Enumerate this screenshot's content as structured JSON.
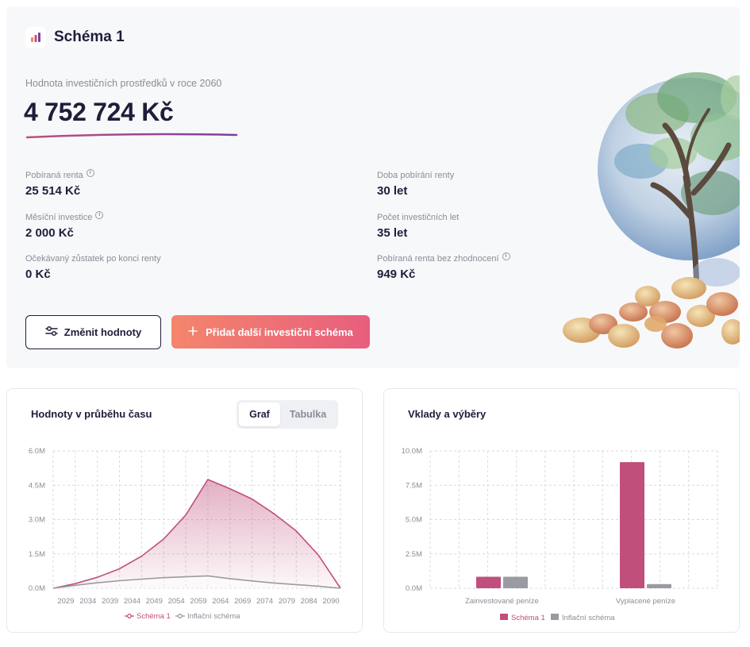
{
  "header": {
    "title": "Schéma 1",
    "subtitle": "Hodnota investičních prostředků v roce 2060",
    "value": "4 752 724 Kč"
  },
  "stats": {
    "rent_label": "Pobíraná renta",
    "rent_value": "25 514 Kč",
    "duration_label": "Doba pobírání renty",
    "duration_value": "30 let",
    "monthly_label": "Měsíční investice",
    "monthly_value": "2 000 Kč",
    "years_label": "Počet investičních let",
    "years_value": "35 let",
    "remaining_label": "Očekávaný zůstatek po konci renty",
    "remaining_value": "0 Kč",
    "rent_noval_label": "Pobíraná renta bez zhodnocení",
    "rent_noval_value": "949 Kč"
  },
  "buttons": {
    "change": "Změnit hodnoty",
    "add": "Přidat další investiční schéma"
  },
  "left_card": {
    "title": "Hodnoty v průběhu času",
    "tab_graph": "Graf",
    "tab_table": "Tabulka"
  },
  "right_card": {
    "title": "Vklady a výběry"
  },
  "colors": {
    "scheme": "#c04f7c",
    "inflation": "#9a9aa3",
    "accent_start": "#f4856c",
    "accent_end": "#e85e7e"
  },
  "chart_data": [
    {
      "type": "area",
      "x_ticks": [
        "2029",
        "2034",
        "2039",
        "2044",
        "2049",
        "2054",
        "2059",
        "2064",
        "2069",
        "2074",
        "2079",
        "2084",
        "2090"
      ],
      "y_ticks": [
        "6.0M",
        "4.5M",
        "3.0M",
        "1.5M",
        "0.0M"
      ],
      "ylim": [
        0,
        6000000
      ],
      "xlim": [
        2025,
        2090
      ],
      "grid": true,
      "legend_position": "bottom",
      "series": [
        {
          "name": "Schéma 1",
          "color": "#c04f7c",
          "points": [
            [
              2025,
              0
            ],
            [
              2030,
              200000
            ],
            [
              2035,
              480000
            ],
            [
              2040,
              850000
            ],
            [
              2045,
              1400000
            ],
            [
              2050,
              2150000
            ],
            [
              2055,
              3200000
            ],
            [
              2060,
              4750000
            ],
            [
              2065,
              4350000
            ],
            [
              2070,
              3900000
            ],
            [
              2075,
              3250000
            ],
            [
              2080,
              2500000
            ],
            [
              2085,
              1450000
            ],
            [
              2090,
              0
            ]
          ]
        },
        {
          "name": "Inflační schéma",
          "color": "#9a9aa3",
          "points": [
            [
              2025,
              0
            ],
            [
              2030,
              130000
            ],
            [
              2035,
              240000
            ],
            [
              2040,
              330000
            ],
            [
              2045,
              400000
            ],
            [
              2050,
              460000
            ],
            [
              2055,
              500000
            ],
            [
              2060,
              540000
            ],
            [
              2065,
              420000
            ],
            [
              2070,
              320000
            ],
            [
              2075,
              230000
            ],
            [
              2080,
              160000
            ],
            [
              2085,
              90000
            ],
            [
              2090,
              0
            ]
          ]
        }
      ]
    },
    {
      "type": "bar",
      "categories": [
        "Zainvestované peníze",
        "Vyplacené peníze"
      ],
      "y_ticks": [
        "10.0M",
        "7.5M",
        "5.0M",
        "2.5M",
        "0.0M"
      ],
      "ylim": [
        0,
        10000000
      ],
      "grid": true,
      "legend_position": "bottom",
      "series": [
        {
          "name": "Schéma 1",
          "color": "#c04f7c",
          "values": [
            840000,
            9180000
          ]
        },
        {
          "name": "Inflační schéma",
          "color": "#9a9aa3",
          "values": [
            840000,
            300000
          ]
        }
      ]
    }
  ]
}
